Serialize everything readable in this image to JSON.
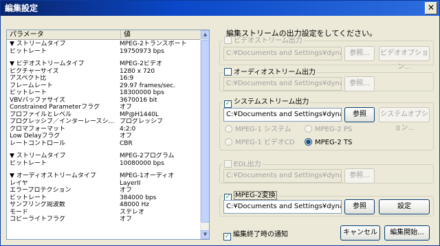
{
  "window": {
    "title": "編集設定"
  },
  "list": {
    "col_param": "パラメータ",
    "col_value": "値",
    "rows": [
      {
        "k": "▼ ストリームタイプ",
        "v": "MPEG-2トランスポート"
      },
      {
        "k": "   ビットレート",
        "v": "19750973 bps"
      },
      {
        "k": "",
        "v": ""
      },
      {
        "k": "▼ ビデオストリームタイプ",
        "v": "MPEG-2ビデオ"
      },
      {
        "k": "   ピクチャーサイズ",
        "v": "1280 x 720"
      },
      {
        "k": "   アスペクト比",
        "v": "16:9"
      },
      {
        "k": "   フレームレート",
        "v": "29.97 frames/sec."
      },
      {
        "k": "   ビットレート",
        "v": "18300000 bps"
      },
      {
        "k": "   VBVバッファサイズ",
        "v": "3670016 bit"
      },
      {
        "k": "   Constrained Parameterフラグ",
        "v": "オフ"
      },
      {
        "k": "   プロファイルとレベル",
        "v": "MP@H1440L"
      },
      {
        "k": "   プログレッシブ／インターレースシ...",
        "v": "プログレッシブ"
      },
      {
        "k": "   クロマフォーマット",
        "v": "4:2:0"
      },
      {
        "k": "   Low Delayフラグ",
        "v": "オフ"
      },
      {
        "k": "   レートコントロール",
        "v": "CBR"
      },
      {
        "k": "",
        "v": ""
      },
      {
        "k": "▼ ストリームタイプ",
        "v": "MPEG-2プログラム"
      },
      {
        "k": "   ビットレート",
        "v": "10080000 bps"
      },
      {
        "k": "",
        "v": ""
      },
      {
        "k": "▼ オーディオストリームタイプ",
        "v": "MPEG-1オーディオ"
      },
      {
        "k": "   レイヤ",
        "v": "LayerII"
      },
      {
        "k": "   エラープロテクション",
        "v": "オフ"
      },
      {
        "k": "   ビットレート",
        "v": "384000 bps"
      },
      {
        "k": "   サンプリング周波数",
        "v": "48000 Hz"
      },
      {
        "k": "   モード",
        "v": "ステレオ"
      },
      {
        "k": "   コピーライトフラグ",
        "v": "オフ"
      }
    ]
  },
  "panel": {
    "description": "編集ストリームの出力設定をしてください。",
    "video": {
      "label": "ビデオストリーム出力",
      "path": "C:¥Documents and Settings¥dynabook¥M",
      "browse": "参照...",
      "options": "ビデオオプション..."
    },
    "audio": {
      "label": "オーディオストリーム出力",
      "path": "C:¥Documents and Settings¥dynabook¥M",
      "browse": "参照..."
    },
    "system": {
      "label": "システムストリーム出力",
      "path": "C:¥Documents and Settings¥dynabook¥M",
      "browse": "参照",
      "options": "システムオプション...",
      "radio_mpeg1_system": "MPEG-1 システム",
      "radio_mpeg2_ps": "MPEG-2 PS",
      "radio_mpeg1_vcd": "MPEG-1 ビデオCD",
      "radio_mpeg2_ts": "MPEG-2 TS"
    },
    "edl": {
      "label": "EDL出力",
      "path": "C:¥Documents and Settings¥dynabook¥M",
      "browse": "参照..."
    },
    "mpeg2": {
      "label": "MPEG-2変換",
      "path": "C:¥Documents and Settings¥dynabook¥M",
      "browse": "参照",
      "settings": "設定"
    },
    "notify": "編集終了時の通知",
    "cancel": "キャンセル",
    "start": "編集開始..."
  }
}
